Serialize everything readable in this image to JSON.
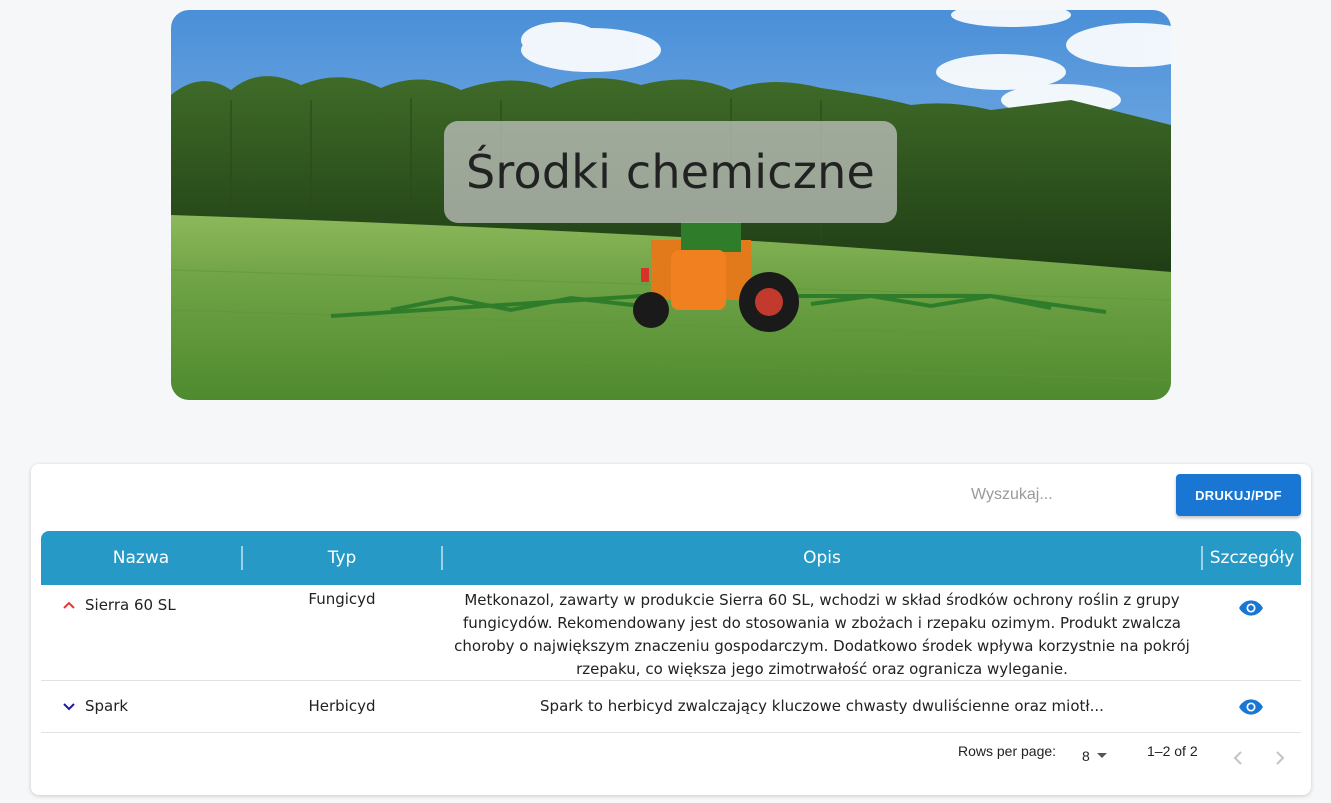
{
  "hero": {
    "title": "Środki chemiczne"
  },
  "toolbar": {
    "search_placeholder": "Wyszukaj...",
    "print_label": "DRUKUJ/PDF"
  },
  "table": {
    "headers": {
      "name": "Nazwa",
      "type": "Typ",
      "description": "Opis",
      "details": "Szczegóły"
    },
    "rows": [
      {
        "name": "Sierra 60 SL",
        "type": "Fungicyd",
        "description": "Metkonazol, zawarty w produkcie Sierra 60 SL, wchodzi w skład środków ochrony roślin z grupy fungicydów. Rekomendowany jest do stosowania w zbożach i rzepaku ozimym. Produkt zwalcza choroby o największym znaczeniu gospodarczym. Dodatkowo środek wpływa korzystnie na pokrój rzepaku, co większa jego zimotrwałość oraz ogranicza wyleganie.",
        "expanded": true
      },
      {
        "name": "Spark",
        "type": "Herbicyd",
        "description": "Spark to herbicyd zwalczający kluczowe chwasty dwuliścienne oraz miotł...",
        "expanded": false
      }
    ]
  },
  "pagination": {
    "rows_per_page_label": "Rows per page:",
    "rows_per_page": "8",
    "range": "1–2 of 2"
  },
  "colors": {
    "header": "#2799c6",
    "button": "#1976d2",
    "eye": "#1976d2",
    "chevron_up": "#e53935",
    "chevron_down": "#1a1aa6"
  }
}
